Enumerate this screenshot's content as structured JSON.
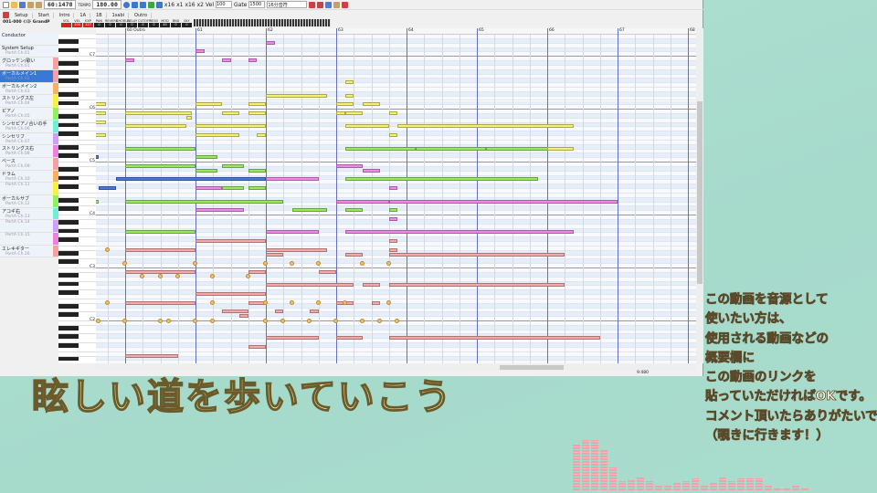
{
  "toolbar": {
    "position": "60:1478",
    "tempo_label": "TEMPO",
    "tempo": "180.00",
    "vel_label": "Vel",
    "vel": "100",
    "gate_label": "Gate",
    "gate": "1500",
    "note_len": "16分音符",
    "zoom_x": [
      "x16",
      "x1",
      "x16",
      "x2"
    ]
  },
  "sections": [
    "Setup",
    "Start",
    "Intro",
    "1A",
    "1B",
    "1sabi",
    "Outro"
  ],
  "track_info": {
    "name": "001-000 ｲﾝｽﾄ GrandP",
    "fields": [
      "0",
      "0",
      "1"
    ],
    "mixer": [
      "VOL",
      "VEL",
      "EXP",
      "PAN",
      "REVERB",
      "CHORUS",
      "DELAY",
      "CUTOFF",
      "RESO",
      "MOD",
      "BND",
      "DLY"
    ],
    "mixer_values": [
      "",
      "100",
      "127",
      "0",
      "0",
      "0",
      "0",
      "0",
      "0",
      "40",
      "0",
      "0"
    ]
  },
  "ruler": {
    "marks": [
      "60 Outro",
      "61",
      "62",
      "63",
      "64",
      "65",
      "66",
      "67",
      "68"
    ]
  },
  "tracks": [
    {
      "name": "Conductor",
      "port": ""
    },
    {
      "name": "System Setup",
      "port": "PortA Ch.01",
      "color": "#eef3fa"
    },
    {
      "name": "グロッケン/歌い",
      "port": "PortA Ch.01",
      "color": "#f8a0a0"
    },
    {
      "name": "ボーカルメイン1",
      "port": "PortA Ch.02",
      "color": "#f8a0a0",
      "selected": true
    },
    {
      "name": "ボーカルメイン2",
      "port": "PortA Ch.03",
      "color": "#f8b060"
    },
    {
      "name": "ストリングス左",
      "port": "PortA Ch.04",
      "color": "#f8f040"
    },
    {
      "name": "ピアノ",
      "port": "PortA Ch.05",
      "color": "#90f060"
    },
    {
      "name": "シンセピアノ合いの手",
      "port": "PortA Ch.06",
      "color": "#70f0d0"
    },
    {
      "name": "シンセリフ",
      "port": "PortA Ch.07",
      "color": "#d0a0f8"
    },
    {
      "name": "ストリングス右",
      "port": "PortA Ch.08",
      "color": "#f080e0"
    },
    {
      "name": "ベース",
      "port": "PortA Ch.09",
      "color": "#f8a0a0"
    },
    {
      "name": "ドラム",
      "port": "PortA Ch.10",
      "color": "#f8b060"
    },
    {
      "name": "",
      "port": "PortA Ch.11",
      "color": "#f8f040"
    },
    {
      "name": "ボーカルサブ",
      "port": "PortA Ch.12",
      "color": "#90f060"
    },
    {
      "name": "アコギ右",
      "port": "PortA Ch.13",
      "color": "#70f0d0"
    },
    {
      "name": "",
      "port": "PortA Ch.14",
      "color": "#d0a0f8"
    },
    {
      "name": "",
      "port": "PortA Ch.15",
      "color": "#f080e0"
    },
    {
      "name": "エレキギター",
      "port": "PortA Ch.16",
      "color": "#f8a0a0"
    }
  ],
  "octave_labels": [
    "C7",
    "C6",
    "C5",
    "C4",
    "C3",
    "C2"
  ],
  "colors": {
    "p": "#f088e8",
    "y": "#f4f070",
    "g": "#98e860",
    "b": "#4a78d8",
    "r": "#f4a8a8",
    "accent": "#3a78d6"
  },
  "notes": [
    [
      8,
      0.5,
      63,
      "p"
    ],
    [
      4,
      0.5,
      61,
      "p"
    ],
    [
      0,
      0.5,
      59,
      "p"
    ],
    [
      5.5,
      0.5,
      59,
      "p"
    ],
    [
      7,
      0.5,
      59,
      "p"
    ],
    [
      12.5,
      0.5,
      54,
      "y"
    ],
    [
      8,
      3.5,
      51,
      "y"
    ],
    [
      12.5,
      0.5,
      51,
      "y"
    ],
    [
      -1.7,
      0.6,
      49,
      "y"
    ],
    [
      4,
      1.5,
      49,
      "y"
    ],
    [
      7,
      1,
      49,
      "y"
    ],
    [
      12,
      1,
      49,
      "y"
    ],
    [
      13.5,
      1,
      49,
      "y"
    ],
    [
      -1.7,
      0.6,
      47,
      "y"
    ],
    [
      0,
      3.8,
      47,
      "y"
    ],
    [
      5.5,
      1,
      47,
      "y"
    ],
    [
      7,
      1,
      47,
      "y"
    ],
    [
      12,
      0.5,
      47,
      "y"
    ],
    [
      12.5,
      1,
      47,
      "y"
    ],
    [
      15,
      0.5,
      47,
      "y"
    ],
    [
      -1.7,
      0.6,
      45,
      "y"
    ],
    [
      3.5,
      0.3,
      46,
      "y"
    ],
    [
      0,
      3.5,
      44,
      "y"
    ],
    [
      4,
      4,
      44,
      "y"
    ],
    [
      12.5,
      2.5,
      44,
      "y"
    ],
    [
      15.5,
      10,
      44,
      "y"
    ],
    [
      -1.7,
      0.6,
      42,
      "y"
    ],
    [
      4,
      2.5,
      42,
      "y"
    ],
    [
      7.5,
      0.5,
      42,
      "y"
    ],
    [
      15,
      0.5,
      42,
      "y"
    ],
    [
      0,
      4,
      39,
      "g"
    ],
    [
      12.5,
      4,
      39,
      "g"
    ],
    [
      16.5,
      4,
      39,
      "g"
    ],
    [
      20.5,
      4,
      39,
      "g"
    ],
    [
      24,
      1.5,
      39,
      "y"
    ],
    [
      -1.7,
      0.2,
      37,
      "b"
    ],
    [
      4,
      1.25,
      37,
      "g"
    ],
    [
      0,
      4,
      35,
      "g"
    ],
    [
      5.5,
      1.25,
      35,
      "g"
    ],
    [
      12,
      1.5,
      35,
      "p"
    ],
    [
      4,
      1.25,
      34,
      "g"
    ],
    [
      7,
      1,
      34,
      "g"
    ],
    [
      13.5,
      1,
      34,
      "p"
    ],
    [
      -0.5,
      8.5,
      32,
      "b"
    ],
    [
      8,
      3,
      32,
      "p"
    ],
    [
      12.5,
      11,
      32,
      "g"
    ],
    [
      -1.5,
      1,
      30,
      "b"
    ],
    [
      4,
      1.5,
      30,
      "p"
    ],
    [
      5.5,
      1.25,
      30,
      "g"
    ],
    [
      7,
      1,
      30,
      "g"
    ],
    [
      15,
      0.5,
      30,
      "p"
    ],
    [
      -1.7,
      0.2,
      27,
      "g"
    ],
    [
      0,
      9,
      27,
      "g"
    ],
    [
      12,
      3,
      27,
      "p"
    ],
    [
      15,
      13,
      27,
      "p"
    ],
    [
      4,
      2.75,
      25,
      "p"
    ],
    [
      9.5,
      2,
      25,
      "g"
    ],
    [
      12.5,
      1,
      25,
      "g"
    ],
    [
      15,
      0.5,
      25,
      "g"
    ],
    [
      15,
      0.5,
      23,
      "p"
    ],
    [
      0,
      4,
      20,
      "g"
    ],
    [
      8,
      3,
      20,
      "p"
    ],
    [
      12.5,
      13,
      20,
      "p"
    ],
    [
      4,
      4,
      18,
      "r"
    ],
    [
      15,
      0.5,
      18,
      "r"
    ],
    [
      0,
      4,
      16,
      "r"
    ],
    [
      8,
      3.5,
      16,
      "r"
    ],
    [
      15,
      0.5,
      16,
      "r"
    ],
    [
      8,
      1,
      15,
      "r"
    ],
    [
      12.5,
      1,
      15,
      "r"
    ],
    [
      15,
      10,
      15,
      "r"
    ],
    [
      0,
      4,
      11,
      "r"
    ],
    [
      7,
      1,
      11,
      "r"
    ],
    [
      11,
      1,
      11,
      "r"
    ],
    [
      8,
      5,
      8,
      "r"
    ],
    [
      13.5,
      1,
      8,
      "r"
    ],
    [
      15,
      10,
      8,
      "r"
    ],
    [
      4,
      4,
      6,
      "r"
    ],
    [
      0,
      4,
      4,
      "r"
    ],
    [
      7,
      1,
      4,
      "r"
    ],
    [
      12,
      1,
      4,
      "r"
    ],
    [
      14,
      0.5,
      4,
      "r"
    ],
    [
      5.5,
      1.5,
      2,
      "r"
    ],
    [
      8.5,
      0.5,
      2,
      "r"
    ],
    [
      10.5,
      0.5,
      2,
      "r"
    ],
    [
      6.5,
      0.5,
      1,
      "r"
    ],
    [
      8,
      3,
      -4,
      "r"
    ],
    [
      12,
      1.5,
      -4,
      "r"
    ],
    [
      15,
      12,
      -4,
      "r"
    ],
    [
      7,
      1,
      -6,
      "r"
    ],
    [
      0,
      3,
      -8,
      "r"
    ]
  ],
  "drum_hits": [
    [
      -1,
      16
    ],
    [
      0,
      13
    ],
    [
      4,
      13
    ],
    [
      8,
      13
    ],
    [
      9.5,
      13
    ],
    [
      11,
      13
    ],
    [
      13.5,
      13
    ],
    [
      15,
      13
    ],
    [
      1,
      10
    ],
    [
      2,
      10
    ],
    [
      3,
      10
    ],
    [
      5,
      10
    ],
    [
      7,
      10
    ],
    [
      -1,
      4
    ],
    [
      5,
      4
    ],
    [
      8,
      4
    ],
    [
      9.5,
      4
    ],
    [
      11,
      4
    ],
    [
      12.5,
      4
    ],
    [
      15,
      4
    ],
    [
      -1.5,
      0
    ],
    [
      0,
      0
    ],
    [
      2,
      0
    ],
    [
      2.5,
      0
    ],
    [
      4,
      0
    ],
    [
      5,
      0
    ],
    [
      8,
      0
    ],
    [
      9,
      0
    ],
    [
      10.5,
      0
    ],
    [
      12,
      0
    ],
    [
      13.5,
      0
    ],
    [
      14.5,
      0
    ],
    [
      15.5,
      0
    ]
  ],
  "status": {
    "position": "9:480"
  },
  "overlay": {
    "title": "眩しい道を歩いていこう",
    "message": [
      "この動画を音源として",
      "使いたい方は、",
      "使用される動画などの",
      "概要欄に",
      "この動画のリンクを",
      "貼っていただければOKです。",
      "コメント頂いたらありがたいです",
      "（覗きに行きます！）"
    ]
  },
  "spectrum": [
    50,
    55,
    55,
    45,
    25,
    10,
    12,
    15,
    10,
    5,
    5,
    8,
    10,
    13,
    5,
    8,
    15,
    10,
    13,
    13,
    13,
    5,
    3,
    3,
    5,
    3
  ]
}
